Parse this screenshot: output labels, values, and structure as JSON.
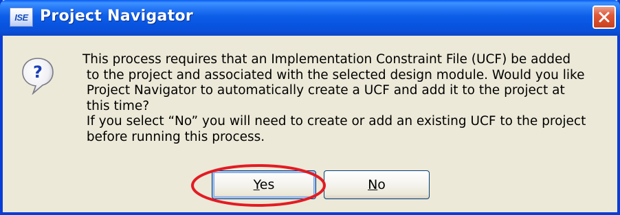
{
  "window": {
    "title": "Project Navigator",
    "app_icon_text": "ISE",
    "close_icon": "close-icon"
  },
  "message": {
    "icon": "question-icon",
    "text": "This process requires that an Implementation Constraint File (UCF) be added\n to the project and associated with the selected design module. Would you like\n Project Navigator to automatically create a UCF and add it to the project at\n this time?\n If you select “No” you will need to create or add an existing UCF to the project\n before running this process."
  },
  "buttons": {
    "yes": {
      "mnemonic": "Y",
      "rest": "es"
    },
    "no": {
      "mnemonic": "N",
      "rest": "o"
    }
  },
  "annotation": {
    "highlight_color": "#e31b23"
  },
  "colors": {
    "titlebar": "#0a54e0",
    "dialog_bg": "#ece9d8",
    "close_button": "#e0593a"
  }
}
